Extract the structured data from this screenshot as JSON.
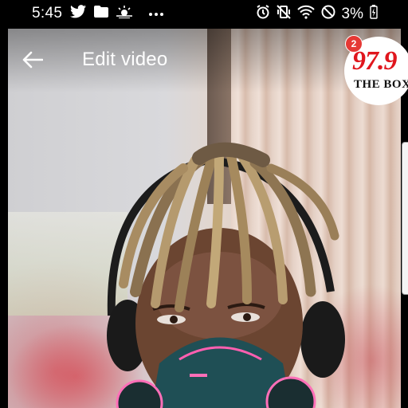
{
  "status_bar": {
    "time": "5:45",
    "battery_percent": "3%",
    "left_icons": [
      "twitter-icon",
      "folder-icon",
      "weather-icon",
      "more-dots-icon"
    ],
    "right_icons": [
      "alarm-icon",
      "vibrate-mute-icon",
      "wifi-icon",
      "do-not-disturb-icon",
      "battery-charging-icon"
    ]
  },
  "app_bar": {
    "title": "Edit video",
    "back_icon": "arrow-left-icon"
  },
  "overlay_logo": {
    "number": "97.9",
    "name": "THE BOX",
    "notification_count": "2"
  },
  "colors": {
    "accent_red": "#e0161d",
    "badge_red": "#e53935",
    "status_bar_bg": "#000000",
    "title_text": "#ffffff"
  }
}
